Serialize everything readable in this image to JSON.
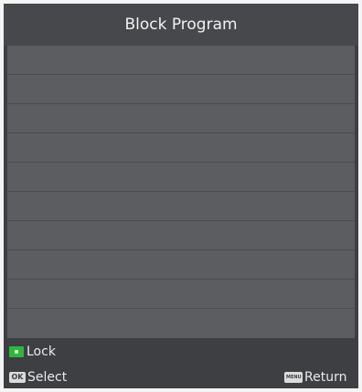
{
  "header": {
    "title": "Block Program"
  },
  "list": {
    "rows": [
      {},
      {},
      {},
      {},
      {},
      {},
      {},
      {},
      {},
      {}
    ]
  },
  "footer": {
    "lock_label": "Lock",
    "ok_key": "OK",
    "select_label": "Select",
    "menu_key": "MENU",
    "return_label": "Return"
  },
  "colors": {
    "green_key": "#2db83d",
    "background": "#3d3f42",
    "list_background": "#5b5d60"
  },
  "icons": {
    "lock_key": "green-button-icon",
    "ok_key": "ok-button-icon",
    "menu_key": "menu-button-icon"
  }
}
